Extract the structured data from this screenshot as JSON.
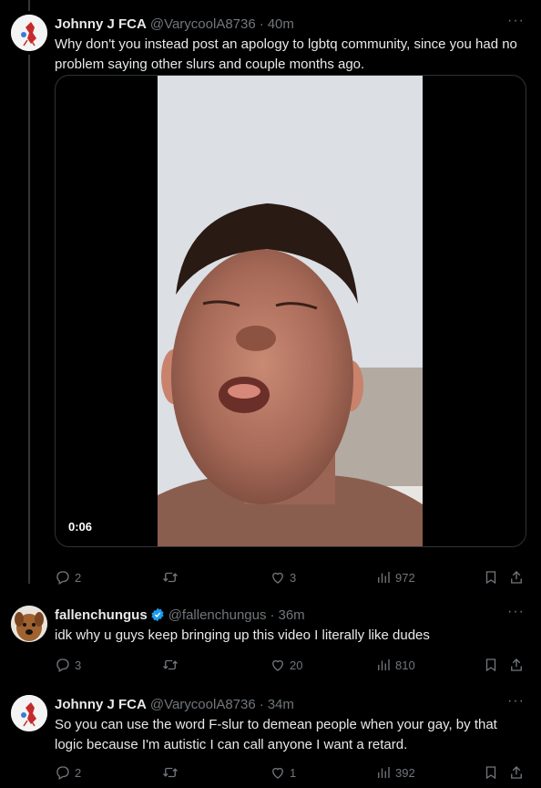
{
  "tweets": [
    {
      "name": "Johnny J FCA",
      "handle": "@VarycoolA8736",
      "time": "40m",
      "text": "Why don't you instead post an apology to lgbtq community, since you had no problem saying other slurs and couple months ago.",
      "video_duration": "0:06",
      "replies": "2",
      "retweets": "",
      "likes": "3",
      "views": "972"
    },
    {
      "name": "fallenchungus",
      "handle": "@fallenchungus",
      "time": "36m",
      "verified": true,
      "text": "idk why u guys keep bringing up this video  I literally like dudes",
      "replies": "3",
      "retweets": "",
      "likes": "20",
      "views": "810"
    },
    {
      "name": "Johnny J FCA",
      "handle": "@VarycoolA8736",
      "time": "34m",
      "text": "So you can use the word F-slur to demean people when your gay, by that logic because I'm autistic I can call anyone I want a retard.",
      "replies": "2",
      "retweets": "",
      "likes": "1",
      "views": "392"
    }
  ],
  "icons": {
    "reply": "reply-icon",
    "retweet": "retweet-icon",
    "like": "heart-icon",
    "views": "views-icon",
    "bookmark": "bookmark-icon",
    "share": "share-icon",
    "more": "more-icon"
  },
  "colors": {
    "background": "#000000",
    "text": "#e7e9ea",
    "muted": "#71767b",
    "verified": "#1d9bf0",
    "border": "#2f3336"
  },
  "ui": {
    "more_label": "···",
    "dot": "·"
  }
}
